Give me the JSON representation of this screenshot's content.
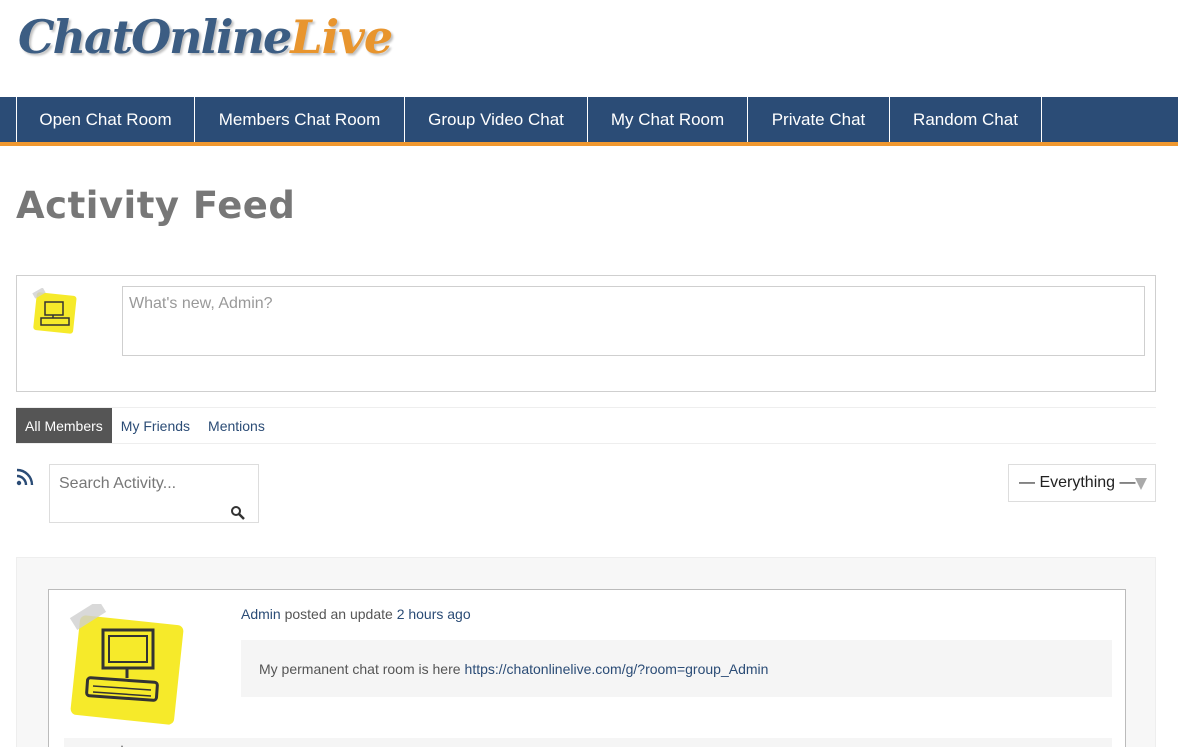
{
  "logo": {
    "part1": "ChatOnline",
    "part2": "Live"
  },
  "nav": {
    "items": [
      {
        "label": "Open Chat Room"
      },
      {
        "label": "Members Chat Room"
      },
      {
        "label": "Group Video Chat"
      },
      {
        "label": "My Chat Room"
      },
      {
        "label": "Private Chat"
      },
      {
        "label": "Random Chat"
      }
    ]
  },
  "page": {
    "title": "Activity Feed"
  },
  "post_form": {
    "placeholder": "What's new, Admin?"
  },
  "tabs": [
    {
      "label": "All Members",
      "active": true
    },
    {
      "label": "My Friends",
      "active": false
    },
    {
      "label": "Mentions",
      "active": false
    }
  ],
  "search": {
    "placeholder": "Search Activity..."
  },
  "filter": {
    "selected": "— Everything —"
  },
  "activity": {
    "user": "Admin",
    "action": "posted an update",
    "time": "2 hours ago",
    "content_text": "My permanent chat room is here",
    "content_link": "https://chatonlinelive.com/g/?room=group_Admin"
  },
  "colors": {
    "nav_bg": "#2b4c76",
    "nav_accent": "#f0982f",
    "link": "#2b4c76",
    "tab_active_bg": "#555555"
  },
  "icons": {
    "rss": "rss-icon",
    "search": "search-icon",
    "comment": "comment-icon",
    "favorite": "star-icon",
    "delete": "delete-icon",
    "avatar": "computer-sticky-note-avatar"
  }
}
